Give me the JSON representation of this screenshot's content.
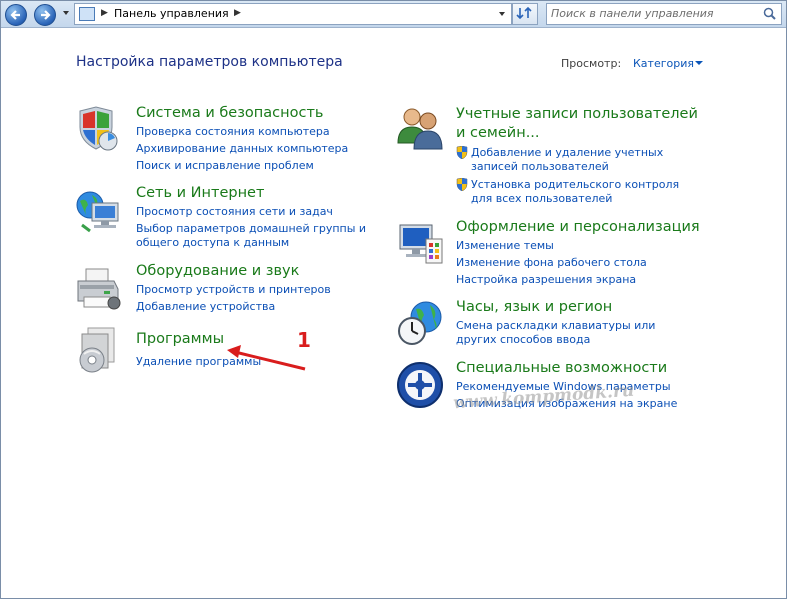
{
  "window": {
    "address_crumb": "Панель управления",
    "search_placeholder": "Поиск в панели управления"
  },
  "header": {
    "title": "Настройка параметров компьютера",
    "view_label": "Просмотр:",
    "view_value": "Категория"
  },
  "categories_left": [
    {
      "title": "Система и безопасность",
      "icon": "shield-computer-icon",
      "links": [
        "Проверка состояния компьютера",
        "Архивирование данных компьютера",
        "Поиск и исправление проблем"
      ]
    },
    {
      "title": "Сеть и Интернет",
      "icon": "network-globe-icon",
      "links": [
        "Просмотр состояния сети и задач",
        "Выбор параметров домашней группы и общего доступа к данным"
      ]
    },
    {
      "title": "Оборудование и звук",
      "icon": "printer-icon",
      "links": [
        "Просмотр устройств и принтеров",
        "Добавление устройства"
      ]
    },
    {
      "title": "Программы",
      "icon": "programs-disc-icon",
      "links": [
        "Удаление программы"
      ]
    }
  ],
  "categories_right": [
    {
      "title": "Учетные записи пользователей и семейн...",
      "icon": "users-icon",
      "links": [
        "Добавление и удаление учетных записей пользователей",
        "Установка родительского контроля для всех пользователей"
      ]
    },
    {
      "title": "Оформление и персонализация",
      "icon": "monitor-palette-icon",
      "links": [
        "Изменение темы",
        "Изменение фона рабочего стола",
        "Настройка разрешения экрана"
      ]
    },
    {
      "title": "Часы, язык и регион",
      "icon": "clock-globe-icon",
      "links": [
        "Смена раскладки клавиатуры или других способов ввода"
      ]
    },
    {
      "title": "Специальные возможности",
      "icon": "accessibility-icon",
      "links": [
        "Рекомендуемые Windows параметры",
        "Оптимизация изображения на экране"
      ]
    }
  ],
  "annotation": {
    "number": "1",
    "color": "#d91d1d"
  },
  "watermark": "www.kompmodk.ru",
  "colors": {
    "category_title": "#1a7a1a",
    "link": "#0b4fb5",
    "page_title": "#1e3287"
  }
}
